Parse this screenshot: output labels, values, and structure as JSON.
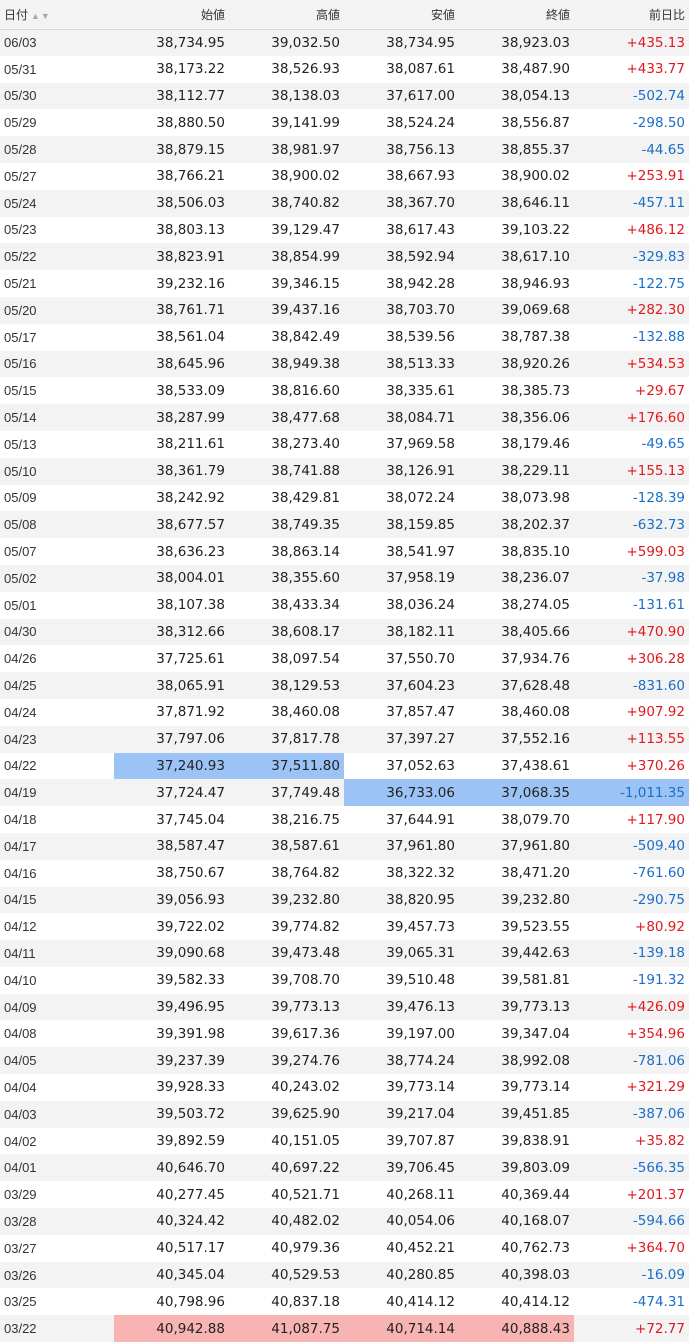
{
  "header": {
    "date": "日付",
    "sort_icon": "▲▼",
    "open": "始値",
    "high": "高値",
    "low": "安値",
    "close": "終値",
    "change": "前日比"
  },
  "colors": {
    "positive": "#e0191e",
    "negative": "#1a6fc9",
    "highlight_blue": "#9cc3f5",
    "highlight_red": "#f8b3b3"
  },
  "rows": [
    {
      "date": "06/03",
      "open": "38,734.95",
      "high": "39,032.50",
      "low": "38,734.95",
      "close": "38,923.03",
      "change": "+435.13"
    },
    {
      "date": "05/31",
      "open": "38,173.22",
      "high": "38,526.93",
      "low": "38,087.61",
      "close": "38,487.90",
      "change": "+433.77"
    },
    {
      "date": "05/30",
      "open": "38,112.77",
      "high": "38,138.03",
      "low": "37,617.00",
      "close": "38,054.13",
      "change": "-502.74"
    },
    {
      "date": "05/29",
      "open": "38,880.50",
      "high": "39,141.99",
      "low": "38,524.24",
      "close": "38,556.87",
      "change": "-298.50"
    },
    {
      "date": "05/28",
      "open": "38,879.15",
      "high": "38,981.97",
      "low": "38,756.13",
      "close": "38,855.37",
      "change": "-44.65"
    },
    {
      "date": "05/27",
      "open": "38,766.21",
      "high": "38,900.02",
      "low": "38,667.93",
      "close": "38,900.02",
      "change": "+253.91"
    },
    {
      "date": "05/24",
      "open": "38,506.03",
      "high": "38,740.82",
      "low": "38,367.70",
      "close": "38,646.11",
      "change": "-457.11"
    },
    {
      "date": "05/23",
      "open": "38,803.13",
      "high": "39,129.47",
      "low": "38,617.43",
      "close": "39,103.22",
      "change": "+486.12"
    },
    {
      "date": "05/22",
      "open": "38,823.91",
      "high": "38,854.99",
      "low": "38,592.94",
      "close": "38,617.10",
      "change": "-329.83"
    },
    {
      "date": "05/21",
      "open": "39,232.16",
      "high": "39,346.15",
      "low": "38,942.28",
      "close": "38,946.93",
      "change": "-122.75"
    },
    {
      "date": "05/20",
      "open": "38,761.71",
      "high": "39,437.16",
      "low": "38,703.70",
      "close": "39,069.68",
      "change": "+282.30"
    },
    {
      "date": "05/17",
      "open": "38,561.04",
      "high": "38,842.49",
      "low": "38,539.56",
      "close": "38,787.38",
      "change": "-132.88"
    },
    {
      "date": "05/16",
      "open": "38,645.96",
      "high": "38,949.38",
      "low": "38,513.33",
      "close": "38,920.26",
      "change": "+534.53"
    },
    {
      "date": "05/15",
      "open": "38,533.09",
      "high": "38,816.60",
      "low": "38,335.61",
      "close": "38,385.73",
      "change": "+29.67"
    },
    {
      "date": "05/14",
      "open": "38,287.99",
      "high": "38,477.68",
      "low": "38,084.71",
      "close": "38,356.06",
      "change": "+176.60"
    },
    {
      "date": "05/13",
      "open": "38,211.61",
      "high": "38,273.40",
      "low": "37,969.58",
      "close": "38,179.46",
      "change": "-49.65"
    },
    {
      "date": "05/10",
      "open": "38,361.79",
      "high": "38,741.88",
      "low": "38,126.91",
      "close": "38,229.11",
      "change": "+155.13"
    },
    {
      "date": "05/09",
      "open": "38,242.92",
      "high": "38,429.81",
      "low": "38,072.24",
      "close": "38,073.98",
      "change": "-128.39"
    },
    {
      "date": "05/08",
      "open": "38,677.57",
      "high": "38,749.35",
      "low": "38,159.85",
      "close": "38,202.37",
      "change": "-632.73"
    },
    {
      "date": "05/07",
      "open": "38,636.23",
      "high": "38,863.14",
      "low": "38,541.97",
      "close": "38,835.10",
      "change": "+599.03"
    },
    {
      "date": "05/02",
      "open": "38,004.01",
      "high": "38,355.60",
      "low": "37,958.19",
      "close": "38,236.07",
      "change": "-37.98"
    },
    {
      "date": "05/01",
      "open": "38,107.38",
      "high": "38,433.34",
      "low": "38,036.24",
      "close": "38,274.05",
      "change": "-131.61"
    },
    {
      "date": "04/30",
      "open": "38,312.66",
      "high": "38,608.17",
      "low": "38,182.11",
      "close": "38,405.66",
      "change": "+470.90"
    },
    {
      "date": "04/26",
      "open": "37,725.61",
      "high": "38,097.54",
      "low": "37,550.70",
      "close": "37,934.76",
      "change": "+306.28"
    },
    {
      "date": "04/25",
      "open": "38,065.91",
      "high": "38,129.53",
      "low": "37,604.23",
      "close": "37,628.48",
      "change": "-831.60"
    },
    {
      "date": "04/24",
      "open": "37,871.92",
      "high": "38,460.08",
      "low": "37,857.47",
      "close": "38,460.08",
      "change": "+907.92"
    },
    {
      "date": "04/23",
      "open": "37,797.06",
      "high": "37,817.78",
      "low": "37,397.27",
      "close": "37,552.16",
      "change": "+113.55"
    },
    {
      "date": "04/22",
      "open": "37,240.93",
      "high": "37,511.80",
      "low": "37,052.63",
      "close": "37,438.61",
      "change": "+370.26",
      "hl": {
        "open": "blue",
        "high": "blue"
      }
    },
    {
      "date": "04/19",
      "open": "37,724.47",
      "high": "37,749.48",
      "low": "36,733.06",
      "close": "37,068.35",
      "change": "-1,011.35",
      "hl": {
        "low": "blue",
        "close": "blue",
        "change": "blue"
      }
    },
    {
      "date": "04/18",
      "open": "37,745.04",
      "high": "38,216.75",
      "low": "37,644.91",
      "close": "38,079.70",
      "change": "+117.90"
    },
    {
      "date": "04/17",
      "open": "38,587.47",
      "high": "38,587.61",
      "low": "37,961.80",
      "close": "37,961.80",
      "change": "-509.40"
    },
    {
      "date": "04/16",
      "open": "38,750.67",
      "high": "38,764.82",
      "low": "38,322.32",
      "close": "38,471.20",
      "change": "-761.60"
    },
    {
      "date": "04/15",
      "open": "39,056.93",
      "high": "39,232.80",
      "low": "38,820.95",
      "close": "39,232.80",
      "change": "-290.75"
    },
    {
      "date": "04/12",
      "open": "39,722.02",
      "high": "39,774.82",
      "low": "39,457.73",
      "close": "39,523.55",
      "change": "+80.92"
    },
    {
      "date": "04/11",
      "open": "39,090.68",
      "high": "39,473.48",
      "low": "39,065.31",
      "close": "39,442.63",
      "change": "-139.18"
    },
    {
      "date": "04/10",
      "open": "39,582.33",
      "high": "39,708.70",
      "low": "39,510.48",
      "close": "39,581.81",
      "change": "-191.32"
    },
    {
      "date": "04/09",
      "open": "39,496.95",
      "high": "39,773.13",
      "low": "39,476.13",
      "close": "39,773.13",
      "change": "+426.09"
    },
    {
      "date": "04/08",
      "open": "39,391.98",
      "high": "39,617.36",
      "low": "39,197.00",
      "close": "39,347.04",
      "change": "+354.96"
    },
    {
      "date": "04/05",
      "open": "39,237.39",
      "high": "39,274.76",
      "low": "38,774.24",
      "close": "38,992.08",
      "change": "-781.06"
    },
    {
      "date": "04/04",
      "open": "39,928.33",
      "high": "40,243.02",
      "low": "39,773.14",
      "close": "39,773.14",
      "change": "+321.29"
    },
    {
      "date": "04/03",
      "open": "39,503.72",
      "high": "39,625.90",
      "low": "39,217.04",
      "close": "39,451.85",
      "change": "-387.06"
    },
    {
      "date": "04/02",
      "open": "39,892.59",
      "high": "40,151.05",
      "low": "39,707.87",
      "close": "39,838.91",
      "change": "+35.82"
    },
    {
      "date": "04/01",
      "open": "40,646.70",
      "high": "40,697.22",
      "low": "39,706.45",
      "close": "39,803.09",
      "change": "-566.35"
    },
    {
      "date": "03/29",
      "open": "40,277.45",
      "high": "40,521.71",
      "low": "40,268.11",
      "close": "40,369.44",
      "change": "+201.37"
    },
    {
      "date": "03/28",
      "open": "40,324.42",
      "high": "40,482.02",
      "low": "40,054.06",
      "close": "40,168.07",
      "change": "-594.66"
    },
    {
      "date": "03/27",
      "open": "40,517.17",
      "high": "40,979.36",
      "low": "40,452.21",
      "close": "40,762.73",
      "change": "+364.70"
    },
    {
      "date": "03/26",
      "open": "40,345.04",
      "high": "40,529.53",
      "low": "40,280.85",
      "close": "40,398.03",
      "change": "-16.09"
    },
    {
      "date": "03/25",
      "open": "40,798.96",
      "high": "40,837.18",
      "low": "40,414.12",
      "close": "40,414.12",
      "change": "-474.31"
    },
    {
      "date": "03/22",
      "open": "40,942.88",
      "high": "41,087.75",
      "low": "40,714.14",
      "close": "40,888.43",
      "change": "+72.77",
      "hl": {
        "open": "red",
        "high": "red",
        "low": "red",
        "close": "red"
      }
    }
  ]
}
